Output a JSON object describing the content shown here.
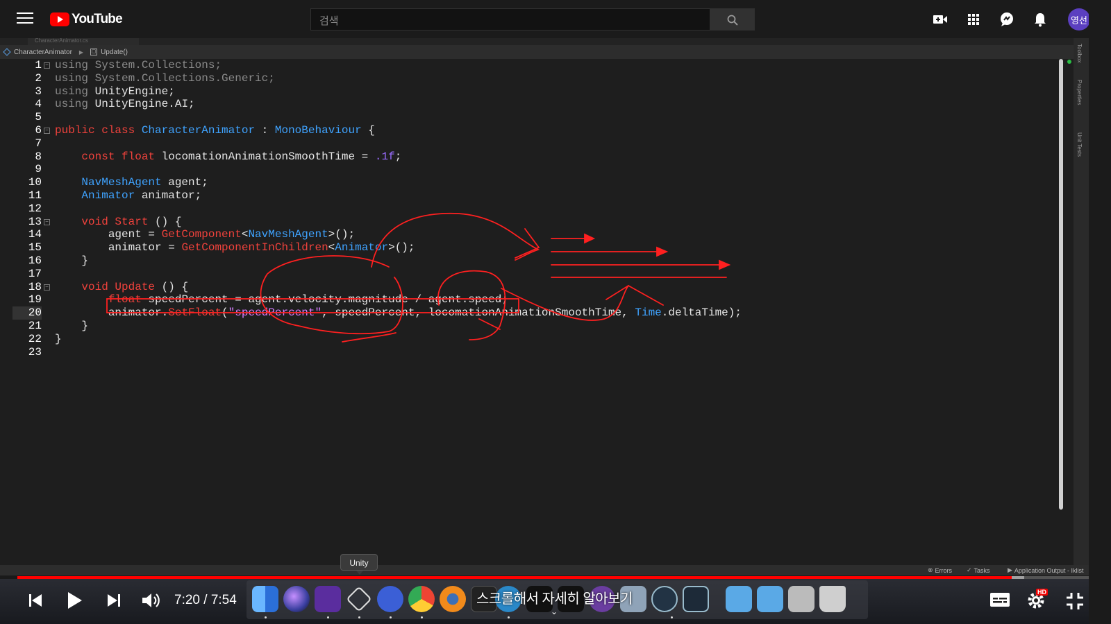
{
  "header": {
    "logo_text": "YouTube",
    "search_placeholder": "검색",
    "avatar_text": "영선"
  },
  "ide": {
    "tab_label": "CharacterAnimator.cs",
    "breadcrumb": [
      "CharacterAnimator",
      "Update()"
    ],
    "right_panels": [
      "Toolbox",
      "Properties",
      "Unit Tests"
    ],
    "status": {
      "errors": "Errors",
      "tasks": "Tasks",
      "app_output": "Application Output - Iklist"
    }
  },
  "code": {
    "current_line": 20,
    "highlighted_line": 19,
    "lines": [
      {
        "n": "1",
        "fold": true
      },
      {
        "n": "2"
      },
      {
        "n": "3"
      },
      {
        "n": "4"
      },
      {
        "n": "5"
      },
      {
        "n": "6",
        "fold": true
      },
      {
        "n": "7"
      },
      {
        "n": "8"
      },
      {
        "n": "9"
      },
      {
        "n": "10"
      },
      {
        "n": "11"
      },
      {
        "n": "12"
      },
      {
        "n": "13",
        "fold": true
      },
      {
        "n": "14"
      },
      {
        "n": "15"
      },
      {
        "n": "16"
      },
      {
        "n": "17"
      },
      {
        "n": "18",
        "fold": true
      },
      {
        "n": "19"
      },
      {
        "n": "20"
      },
      {
        "n": "21"
      },
      {
        "n": "22"
      },
      {
        "n": "23"
      }
    ],
    "tokens": {
      "l1": [
        "using",
        " System.Collections;"
      ],
      "l2": [
        "using",
        " System.Collections.Generic;"
      ],
      "l3": [
        "using",
        " UnityEngine;"
      ],
      "l4": [
        "using",
        " UnityEngine.AI;"
      ],
      "l6": [
        "public class ",
        "CharacterAnimator",
        " : ",
        "MonoBehaviour",
        " {"
      ],
      "l8": [
        "    ",
        "const float",
        " locomationAnimationSmoothTime = ",
        ".1f",
        ";"
      ],
      "l10": [
        "    ",
        "NavMeshAgent",
        " agent;"
      ],
      "l11": [
        "    ",
        "Animator",
        " animator;"
      ],
      "l13": [
        "    ",
        "void Start",
        " () {"
      ],
      "l14": [
        "        agent = ",
        "GetComponent",
        "<",
        "NavMeshAgent",
        ">();"
      ],
      "l15": [
        "        animator = ",
        "GetComponentInChildren",
        "<",
        "Animator",
        ">();"
      ],
      "l16": [
        "    }"
      ],
      "l18": [
        "    ",
        "void Update",
        " () {"
      ],
      "l19": [
        "        ",
        "float",
        " speedPercent = agent.velocity.magnitude / agent.speed;"
      ],
      "l20": [
        "        animator.",
        "SetFloat",
        "(",
        "\"speedPercent\"",
        ", speedPercent, locomationAnimationSmoothTime, ",
        "Time",
        ".deltaTime);"
      ],
      "l21": [
        "    }"
      ],
      "l22": [
        "}"
      ]
    }
  },
  "player": {
    "current_time": "7:20",
    "duration": "7:54",
    "time_separator": " / ",
    "progress_fraction": 0.928,
    "buffered_fraction": 0.94,
    "subtitle": "스크롤해서 자세히 알아보기",
    "hd_badge": "HD"
  },
  "dock": {
    "tooltip": "Unity",
    "apps": [
      "Finder",
      "Siri",
      "Visual Studio",
      "Unity",
      "Mix",
      "Chrome",
      "Blender",
      "Terminal",
      "Cloud",
      "Monitor",
      "Black",
      "Vector",
      "Preview",
      "Sourcetree",
      "Box",
      "Folder",
      "Folder",
      "Documents",
      "Trash"
    ]
  },
  "colors": {
    "accent_red": "#ff0000",
    "keyword_red": "#f0423c",
    "type_blue": "#3fa3ff",
    "string_pink": "#d47eff"
  }
}
